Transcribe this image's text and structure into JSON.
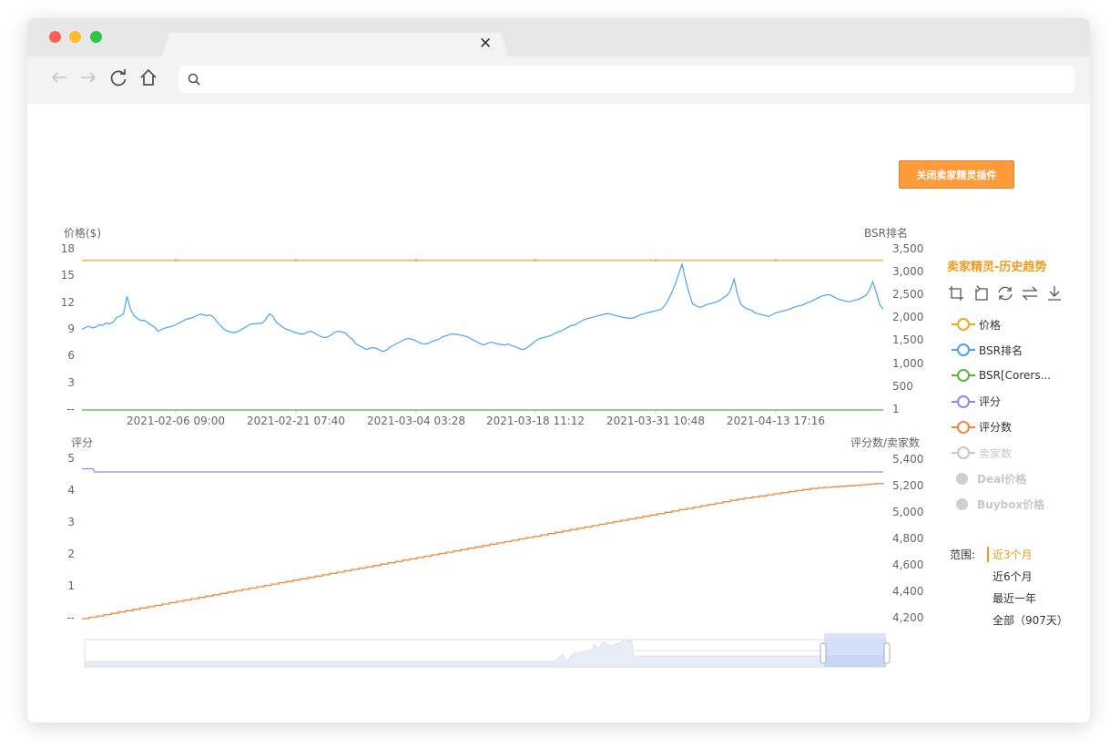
{
  "browser": {
    "tab_close": "✕",
    "address": ""
  },
  "plugin": {
    "close_button": "关闭卖家精灵插件",
    "panel_title": "卖家精灵-历史趋势",
    "legend": [
      {
        "label": "价格",
        "color": "#f5a623",
        "enabled": true
      },
      {
        "label": "BSR排名",
        "color": "#4aa3ef",
        "enabled": true
      },
      {
        "label": "BSR[Corers...",
        "color": "#51b843",
        "enabled": true
      },
      {
        "label": "评分",
        "color": "#8b8bec",
        "enabled": true
      },
      {
        "label": "评分数",
        "color": "#f5863b",
        "enabled": true
      },
      {
        "label": "卖家数",
        "color": "#c8c8c8",
        "enabled": false
      },
      {
        "label": "Deal价格",
        "color": "#c8c8c8",
        "enabled": false
      },
      {
        "label": "Buybox价格",
        "color": "#c8c8c8",
        "enabled": false
      }
    ],
    "range_label": "范围:",
    "ranges": [
      "近3个月",
      "近6个月",
      "最近一年",
      "全部（907天）"
    ],
    "active_range": "近3个月",
    "tools": [
      "zoom-icon",
      "zoom-reset-icon",
      "restore-icon",
      "switch-icon",
      "download-icon"
    ]
  },
  "chart_data": [
    {
      "type": "line",
      "left_axis_title": "价格($)",
      "right_axis_title": "BSR排名",
      "left_ticks": [
        "18",
        "15",
        "12",
        "9",
        "6",
        "3",
        "--"
      ],
      "right_ticks": [
        "3,500",
        "3,000",
        "2,500",
        "2,000",
        "1,500",
        "1,000",
        "500",
        "1"
      ],
      "x_ticks": [
        "2021-02-06 09:00",
        "2021-02-21 07:40",
        "2021-03-04 03:28",
        "2021-03-18 11:12",
        "2021-03-31 10:48",
        "2021-04-13 17:16"
      ],
      "x_range": [
        "2021-01-25",
        "2021-04-26"
      ],
      "left_range": [
        0,
        18
      ],
      "right_range": [
        1,
        3500
      ],
      "series": [
        {
          "name": "价格",
          "axis": "left",
          "color": "#f5a623",
          "values": [
            16.8,
            16.8
          ]
        },
        {
          "name": "BSR排名",
          "axis": "right",
          "color": "#4aa3ef",
          "values": [
            1760,
            1800,
            1830,
            1790,
            1810,
            1860,
            1850,
            1900,
            1880,
            1920,
            2020,
            2050,
            2100,
            2480,
            2200,
            2060,
            2000,
            1950,
            1960,
            1900,
            1850,
            1800,
            1720,
            1760,
            1790,
            1810,
            1830,
            1860,
            1900,
            1940,
            1980,
            2000,
            2020,
            2060,
            2090,
            2080,
            2060,
            2070,
            2020,
            1920,
            1840,
            1760,
            1720,
            1700,
            1690,
            1710,
            1760,
            1800,
            1850,
            1880,
            1880,
            1890,
            1900,
            1980,
            2100,
            2050,
            1920,
            1860,
            1800,
            1760,
            1740,
            1700,
            1680,
            1660,
            1660,
            1700,
            1720,
            1680,
            1640,
            1600,
            1580,
            1600,
            1650,
            1700,
            1720,
            1700,
            1680,
            1600,
            1540,
            1440,
            1400,
            1360,
            1320,
            1350,
            1360,
            1340,
            1300,
            1280,
            1320,
            1380,
            1420,
            1460,
            1500,
            1540,
            1560,
            1550,
            1520,
            1480,
            1450,
            1440,
            1460,
            1500,
            1520,
            1550,
            1600,
            1620,
            1650,
            1660,
            1650,
            1640,
            1620,
            1600,
            1560,
            1520,
            1480,
            1440,
            1420,
            1460,
            1480,
            1460,
            1440,
            1430,
            1420,
            1440,
            1400,
            1380,
            1340,
            1320,
            1340,
            1400,
            1460,
            1520,
            1560,
            1580,
            1600,
            1620,
            1660,
            1700,
            1720,
            1760,
            1800,
            1840,
            1860,
            1900,
            1940,
            1980,
            2000,
            2020,
            2040,
            2060,
            2080,
            2100,
            2100,
            2080,
            2060,
            2040,
            2020,
            2010,
            2000,
            2010,
            2040,
            2080,
            2100,
            2120,
            2140,
            2160,
            2180,
            2200,
            2280,
            2400,
            2560,
            2740,
            2960,
            3180,
            2840,
            2560,
            2320,
            2280,
            2240,
            2260,
            2300,
            2320,
            2340,
            2360,
            2400,
            2460,
            2500,
            2620,
            2860,
            2520,
            2300,
            2240,
            2200,
            2180,
            2120,
            2100,
            2080,
            2060,
            2040,
            2080,
            2120,
            2140,
            2160,
            2180,
            2200,
            2240,
            2260,
            2280,
            2300,
            2340,
            2360,
            2400,
            2440,
            2480,
            2500,
            2520,
            2500,
            2460,
            2420,
            2400,
            2380,
            2360,
            2380,
            2400,
            2420,
            2460,
            2500,
            2620,
            2800,
            2560,
            2300,
            2200
          ]
        },
        {
          "name": "BSR[Corers...",
          "axis": "right",
          "color": "#51b843",
          "values": [
            1,
            1
          ]
        }
      ]
    },
    {
      "type": "line",
      "left_axis_title": "评分",
      "right_axis_title": "评分数/卖家数",
      "left_ticks": [
        "5",
        "4",
        "3",
        "2",
        "1",
        "--"
      ],
      "right_ticks": [
        "5,400",
        "5,200",
        "5,000",
        "4,800",
        "4,600",
        "4,400",
        "4,200"
      ],
      "left_range": [
        0,
        5
      ],
      "right_range": [
        4200,
        5400
      ],
      "series": [
        {
          "name": "评分",
          "axis": "left",
          "color": "#8b8bec",
          "values": [
            4.7,
            4.7,
            4.6,
            4.6
          ]
        },
        {
          "name": "评分数",
          "axis": "right",
          "color": "#f5863b",
          "values": [
            4200,
            4300,
            4400,
            4500,
            4600,
            4700,
            4800,
            4900,
            5000,
            5100,
            5180,
            5220
          ]
        }
      ]
    }
  ]
}
